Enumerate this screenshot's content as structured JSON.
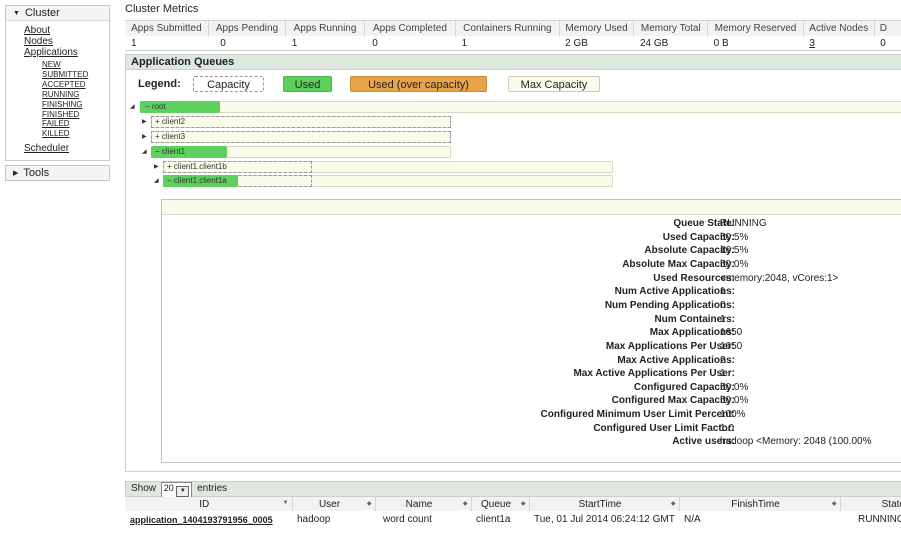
{
  "nav": {
    "cluster_label": "Cluster",
    "links": [
      "About",
      "Nodes",
      "Applications"
    ],
    "app_states": [
      "NEW",
      "SUBMITTED",
      "ACCEPTED",
      "RUNNING",
      "FINISHING",
      "FINISHED",
      "FAILED",
      "KILLED"
    ],
    "scheduler": "Scheduler",
    "tools_label": "Tools"
  },
  "metrics": {
    "title": "Cluster Metrics",
    "headers": [
      "Apps Submitted",
      "Apps Pending",
      "Apps Running",
      "Apps Completed",
      "Containers Running",
      "Memory Used",
      "Memory Total",
      "Memory Reserved",
      "Active Nodes",
      "D"
    ],
    "values": [
      "1",
      "0",
      "1",
      "0",
      "1",
      "2 GB",
      "24 GB",
      "0 B",
      "3",
      "0"
    ]
  },
  "queues": {
    "title": "Application Queues",
    "legend_label": "Legend:",
    "legend": {
      "capacity": "Capacity",
      "used": "Used",
      "over": "Used (over capacity)",
      "max": "Max Capacity"
    },
    "tree": {
      "root": "root",
      "client2": "client2",
      "client3": "client3",
      "client1": "client1",
      "client1b": "client1.client1b",
      "client1a": "client1.client1a"
    },
    "details": [
      {
        "label": "Queue State:",
        "value": "RUNNING"
      },
      {
        "label": "Used Capacity:",
        "value": "50.5%"
      },
      {
        "label": "Absolute Capacity:",
        "value": "16.5%"
      },
      {
        "label": "Absolute Max Capacity:",
        "value": "50.0%"
      },
      {
        "label": "Used Resources:",
        "value": "<memory:2048, vCores:1>"
      },
      {
        "label": "Num Active Applications:",
        "value": "1"
      },
      {
        "label": "Num Pending Applications:",
        "value": "0"
      },
      {
        "label": "Num Containers:",
        "value": "1"
      },
      {
        "label": "Max Applications:",
        "value": "1650"
      },
      {
        "label": "Max Applications Per User:",
        "value": "1650"
      },
      {
        "label": "Max Active Applications:",
        "value": "2"
      },
      {
        "label": "Max Active Applications Per User:",
        "value": "1"
      },
      {
        "label": "Configured Capacity:",
        "value": "50.0%"
      },
      {
        "label": "Configured Max Capacity:",
        "value": "50.0%"
      },
      {
        "label": "Configured Minimum User Limit Percent:",
        "value": "100%"
      },
      {
        "label": "Configured User Limit Factor:",
        "value": "1.0"
      },
      {
        "label": "Active users:",
        "value": "hadoop <Memory: 2048 (100.00%"
      }
    ]
  },
  "apps": {
    "show_label": "Show",
    "page_size": "20",
    "entries_label": "entries",
    "columns": [
      "ID",
      "User",
      "Name",
      "Queue",
      "StartTime",
      "FinishTime",
      "State"
    ],
    "rows": [
      {
        "id": "application_1404193791956_0005",
        "user": "hadoop",
        "name": "word count",
        "queue": "client1a",
        "start": "Tue, 01 Jul 2014 06:24:12 GMT",
        "finish": "N/A",
        "state": "RUNNING"
      }
    ]
  },
  "colors": {
    "used": "#5dd05d",
    "over_capacity": "#e8a44a",
    "max_capacity": "#fbfbec",
    "section_header": "#dfe8df"
  }
}
